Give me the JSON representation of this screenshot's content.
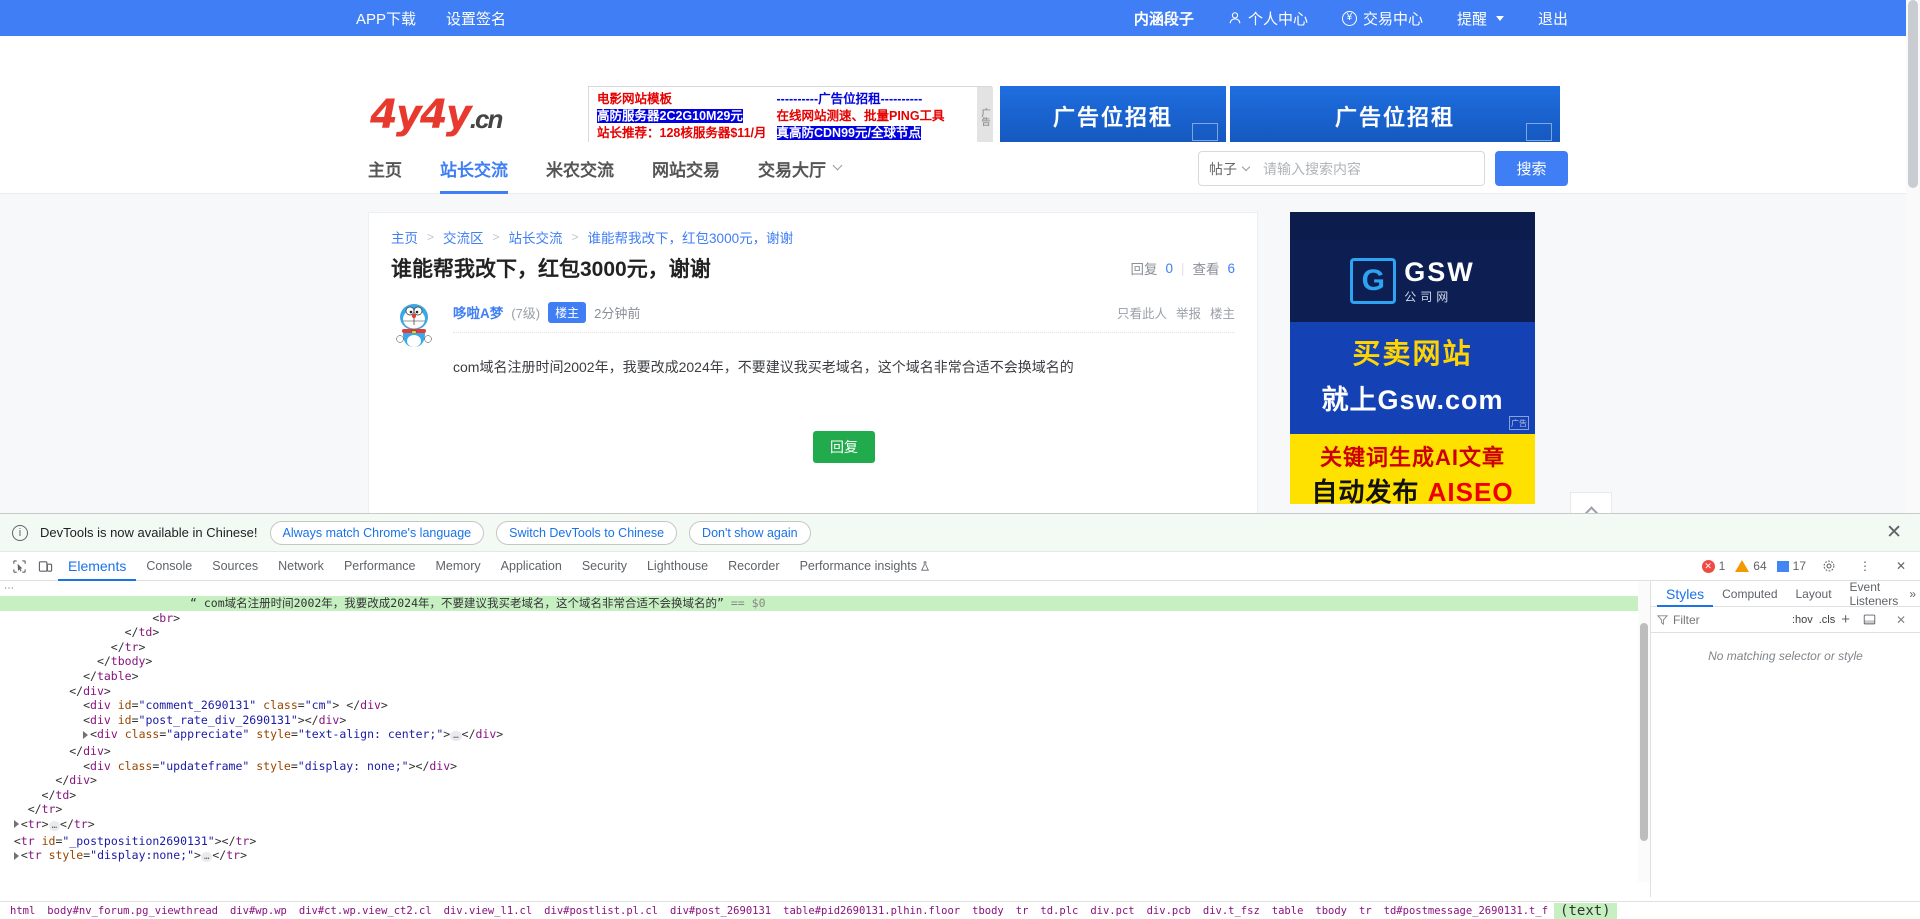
{
  "topbar": {
    "left": [
      {
        "label": "APP下载",
        "name": "app-download-link"
      },
      {
        "label": "设置签名",
        "name": "set-signature-link"
      }
    ],
    "right": [
      {
        "label": "内涵段子",
        "name": "neihan-duanzi-link",
        "icon": null
      },
      {
        "label": "个人中心",
        "name": "user-center-link",
        "icon": "user-icon"
      },
      {
        "label": "交易中心",
        "name": "trade-center-link",
        "icon": "yuan-circle-icon"
      },
      {
        "label": "提醒",
        "name": "notifications-link",
        "icon": "caret-down-icon"
      },
      {
        "label": "退出",
        "name": "logout-link",
        "icon": null
      }
    ]
  },
  "logo": {
    "main": "4y4y",
    "suffix": ".cn"
  },
  "text_ad": {
    "col1": [
      "电影网站模板",
      "高防服务器2C2G10M29元",
      "站长推荐：128核服务器$11/月"
    ],
    "col2": [
      "----------广告位招租----------",
      "在线网站测速、批量PING工具",
      "真高防CDN99元/全球节点"
    ],
    "side_label": "广告"
  },
  "banners": [
    {
      "label": "广告位招租",
      "name": "banner-ad-1"
    },
    {
      "label": "广告位招租",
      "name": "banner-ad-2"
    }
  ],
  "nav": {
    "items": [
      {
        "label": "主页",
        "active": false,
        "name": "nav-home"
      },
      {
        "label": "站长交流",
        "active": true,
        "name": "nav-webmaster-exchange"
      },
      {
        "label": "米农交流",
        "active": false,
        "name": "nav-domainer-exchange"
      },
      {
        "label": "网站交易",
        "active": false,
        "name": "nav-site-trade"
      },
      {
        "label": "交易大厅",
        "active": false,
        "name": "nav-trade-hall",
        "dropdown": true
      }
    ]
  },
  "search": {
    "scope": "帖子",
    "placeholder": "请输入搜索内容",
    "value": "",
    "button": "搜索"
  },
  "thread": {
    "breadcrumb": [
      "主页",
      "交流区",
      "站长交流",
      "谁能帮我改下，红包3000元，谢谢"
    ],
    "title": "谁能帮我改下，红包3000元，谢谢",
    "stats": {
      "reply_label": "回复",
      "reply_count": "0",
      "view_label": "查看",
      "view_count": "6"
    },
    "post": {
      "username": "哆啦A梦",
      "level": "(7级)",
      "badge": "楼主",
      "time": "2分钟前",
      "actions": [
        "只看此人",
        "举报",
        "楼主"
      ],
      "content": "com域名注册时间2002年，我要改成2024年，不要建议我买老域名，这个域名非常合适不会换域名的",
      "reply_button": "回复"
    }
  },
  "side_ad": {
    "brand_mark": "G",
    "brand_title": "GSW",
    "brand_sub": "公司网",
    "line1": "买卖网站",
    "line2": "就上Gsw.com",
    "yellow1": "关键词生成AI文章",
    "yellow2_a": "自动发布 ",
    "yellow2_b": "AISEO",
    "corner": "广告"
  },
  "devtools": {
    "notice": {
      "message": "DevTools is now available in Chinese!",
      "buttons": [
        "Always match Chrome's language",
        "Switch DevTools to Chinese",
        "Don't show again"
      ],
      "close": "✕"
    },
    "tabs": [
      "Elements",
      "Console",
      "Sources",
      "Network",
      "Performance",
      "Memory",
      "Application",
      "Security",
      "Lighthouse",
      "Recorder",
      "Performance insights"
    ],
    "selected_tab": "Elements",
    "counters": {
      "errors": "1",
      "warnings": "64",
      "info": "17"
    },
    "dom_lines": [
      {
        "indent": 0,
        "sel": true,
        "parts": [
          {
            "t": "“ com域名注册时间2002年，我要改成2024年，不要建议我买老域名，这个域名非常合适不会换域名的”",
            "c": "txtc"
          },
          {
            "t": " == ",
            "c": "eqc"
          },
          {
            "t": "$0",
            "c": "eqc"
          }
        ]
      },
      {
        "indent": 11,
        "parts": [
          {
            "t": "<",
            "c": "punc"
          },
          {
            "t": "br",
            "c": "tagc"
          },
          {
            "t": ">",
            "c": "punc"
          }
        ]
      },
      {
        "indent": 9,
        "parts": [
          {
            "t": "</",
            "c": "punc"
          },
          {
            "t": "td",
            "c": "tagc"
          },
          {
            "t": ">",
            "c": "punc"
          }
        ]
      },
      {
        "indent": 8,
        "parts": [
          {
            "t": "</",
            "c": "punc"
          },
          {
            "t": "tr",
            "c": "tagc"
          },
          {
            "t": ">",
            "c": "punc"
          }
        ]
      },
      {
        "indent": 7,
        "parts": [
          {
            "t": "</",
            "c": "punc"
          },
          {
            "t": "tbody",
            "c": "tagc"
          },
          {
            "t": ">",
            "c": "punc"
          }
        ]
      },
      {
        "indent": 6,
        "parts": [
          {
            "t": "</",
            "c": "punc"
          },
          {
            "t": "table",
            "c": "tagc"
          },
          {
            "t": ">",
            "c": "punc"
          }
        ]
      },
      {
        "indent": 5,
        "parts": [
          {
            "t": "</",
            "c": "punc"
          },
          {
            "t": "div",
            "c": "tagc"
          },
          {
            "t": ">",
            "c": "punc"
          }
        ]
      },
      {
        "indent": 6,
        "parts": [
          {
            "t": "<",
            "c": "punc"
          },
          {
            "t": "div ",
            "c": "tagc"
          },
          {
            "t": "id",
            "c": "attrn"
          },
          {
            "t": "=",
            "c": "punc"
          },
          {
            "t": "\"comment_2690131\"",
            "c": "attrv"
          },
          {
            "t": " class",
            "c": "attrn"
          },
          {
            "t": "=",
            "c": "punc"
          },
          {
            "t": "\"cm\"",
            "c": "attrv"
          },
          {
            "t": ">",
            "c": "punc"
          },
          {
            "t": " </",
            "c": "punc"
          },
          {
            "t": "div",
            "c": "tagc"
          },
          {
            "t": ">",
            "c": "punc"
          }
        ]
      },
      {
        "indent": 6,
        "parts": [
          {
            "t": "<",
            "c": "punc"
          },
          {
            "t": "div ",
            "c": "tagc"
          },
          {
            "t": "id",
            "c": "attrn"
          },
          {
            "t": "=",
            "c": "punc"
          },
          {
            "t": "\"post_rate_div_2690131\"",
            "c": "attrv"
          },
          {
            "t": ">",
            "c": "punc"
          },
          {
            "t": "</",
            "c": "punc"
          },
          {
            "t": "div",
            "c": "tagc"
          },
          {
            "t": ">",
            "c": "punc"
          }
        ]
      },
      {
        "indent": 6,
        "triangle": true,
        "parts": [
          {
            "t": "<",
            "c": "punc"
          },
          {
            "t": "div ",
            "c": "tagc"
          },
          {
            "t": "class",
            "c": "attrn"
          },
          {
            "t": "=",
            "c": "punc"
          },
          {
            "t": "\"appreciate\"",
            "c": "attrv"
          },
          {
            "t": " style",
            "c": "attrn"
          },
          {
            "t": "=",
            "c": "punc"
          },
          {
            "t": "\"text-align: center;\"",
            "c": "attrv"
          },
          {
            "t": ">",
            "c": "punc"
          },
          {
            "t": "…",
            "c": "elp"
          },
          {
            "t": "</",
            "c": "punc"
          },
          {
            "t": "div",
            "c": "tagc"
          },
          {
            "t": ">",
            "c": "punc"
          }
        ]
      },
      {
        "indent": 5,
        "parts": [
          {
            "t": "</",
            "c": "punc"
          },
          {
            "t": "div",
            "c": "tagc"
          },
          {
            "t": ">",
            "c": "punc"
          }
        ]
      },
      {
        "indent": 6,
        "parts": [
          {
            "t": "<",
            "c": "punc"
          },
          {
            "t": "div ",
            "c": "tagc"
          },
          {
            "t": "class",
            "c": "attrn"
          },
          {
            "t": "=",
            "c": "punc"
          },
          {
            "t": "\"updateframe\"",
            "c": "attrv"
          },
          {
            "t": " style",
            "c": "attrn"
          },
          {
            "t": "=",
            "c": "punc"
          },
          {
            "t": "\"display: none;\"",
            "c": "attrv"
          },
          {
            "t": ">",
            "c": "punc"
          },
          {
            "t": "</",
            "c": "punc"
          },
          {
            "t": "div",
            "c": "tagc"
          },
          {
            "t": ">",
            "c": "punc"
          }
        ]
      },
      {
        "indent": 4,
        "parts": [
          {
            "t": "</",
            "c": "punc"
          },
          {
            "t": "div",
            "c": "tagc"
          },
          {
            "t": ">",
            "c": "punc"
          }
        ]
      },
      {
        "indent": 3,
        "parts": [
          {
            "t": "</",
            "c": "punc"
          },
          {
            "t": "td",
            "c": "tagc"
          },
          {
            "t": ">",
            "c": "punc"
          }
        ]
      },
      {
        "indent": 2,
        "parts": [
          {
            "t": "</",
            "c": "punc"
          },
          {
            "t": "tr",
            "c": "tagc"
          },
          {
            "t": ">",
            "c": "punc"
          }
        ]
      },
      {
        "indent": 1,
        "triangle": true,
        "parts": [
          {
            "t": "<",
            "c": "punc"
          },
          {
            "t": "tr",
            "c": "tagc"
          },
          {
            "t": ">",
            "c": "punc"
          },
          {
            "t": "…",
            "c": "elp"
          },
          {
            "t": "</",
            "c": "punc"
          },
          {
            "t": "tr",
            "c": "tagc"
          },
          {
            "t": ">",
            "c": "punc"
          }
        ]
      },
      {
        "indent": 1,
        "parts": [
          {
            "t": "<",
            "c": "punc"
          },
          {
            "t": "tr ",
            "c": "tagc"
          },
          {
            "t": "id",
            "c": "attrn"
          },
          {
            "t": "=",
            "c": "punc"
          },
          {
            "t": "\"_postposition2690131\"",
            "c": "attrv"
          },
          {
            "t": ">",
            "c": "punc"
          },
          {
            "t": "</",
            "c": "punc"
          },
          {
            "t": "tr",
            "c": "tagc"
          },
          {
            "t": ">",
            "c": "punc"
          }
        ]
      },
      {
        "indent": 1,
        "triangle": true,
        "parts": [
          {
            "t": "<",
            "c": "punc"
          },
          {
            "t": "tr ",
            "c": "tagc"
          },
          {
            "t": "style",
            "c": "attrn"
          },
          {
            "t": "=",
            "c": "punc"
          },
          {
            "t": "\"display:none;\"",
            "c": "attrv"
          },
          {
            "t": ">",
            "c": "punc"
          },
          {
            "t": "…",
            "c": "elp"
          },
          {
            "t": "</",
            "c": "punc"
          },
          {
            "t": "tr",
            "c": "tagc"
          },
          {
            "t": ">",
            "c": "punc"
          }
        ]
      }
    ],
    "styles_panel": {
      "tabs": [
        "Styles",
        "Computed",
        "Layout",
        "Event Listeners"
      ],
      "selected": "Styles",
      "filter_placeholder": "Filter",
      "hov": ":hov",
      "cls": ".cls",
      "empty": "No matching selector or style"
    },
    "breadcrumb": [
      {
        "t": "html",
        "sel": false
      },
      {
        "t": "body#nv_forum.pg_viewthread",
        "sel": false
      },
      {
        "t": "div#wp.wp",
        "sel": false
      },
      {
        "t": "div#ct.wp.view_ct2.cl",
        "sel": false
      },
      {
        "t": "div.view_l1.cl",
        "sel": false
      },
      {
        "t": "div#postlist.pl.cl",
        "sel": false
      },
      {
        "t": "div#post_2690131",
        "sel": false
      },
      {
        "t": "table#pid2690131.plhin.floor",
        "sel": false
      },
      {
        "t": "tbody",
        "sel": false
      },
      {
        "t": "tr",
        "sel": false
      },
      {
        "t": "td.plc",
        "sel": false
      },
      {
        "t": "div.pct",
        "sel": false
      },
      {
        "t": "div.pcb",
        "sel": false
      },
      {
        "t": "div.t_fsz",
        "sel": false
      },
      {
        "t": "table",
        "sel": false
      },
      {
        "t": "tbody",
        "sel": false
      },
      {
        "t": "tr",
        "sel": false
      },
      {
        "t": "td#postmessage_2690131.t_f",
        "sel": false
      },
      {
        "t": "(text)",
        "sel": true
      }
    ]
  }
}
